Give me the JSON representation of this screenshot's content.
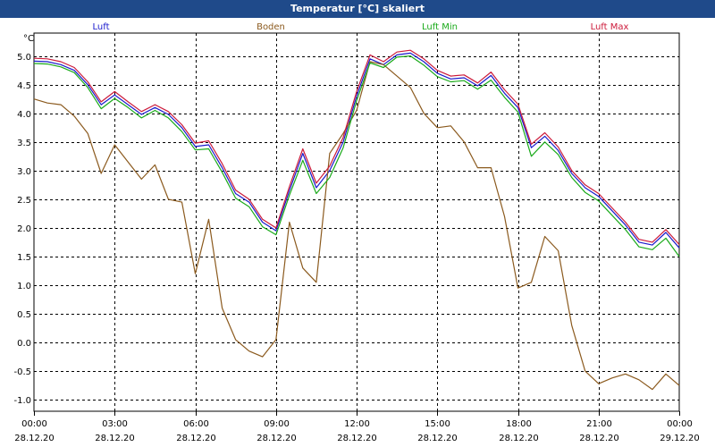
{
  "window": {
    "title": "Temperatur [°C] skaliert"
  },
  "colors": {
    "Luft": "#1a1acc",
    "Boden": "#8b5a1e",
    "Luft Min": "#1aaa1a",
    "Luft Max": "#cc1a3a",
    "grid": "#000000"
  },
  "chart_data": {
    "type": "line",
    "title": "Temperatur [°C] skaliert",
    "ylabel": "°C",
    "xlabel": "",
    "ylim": [
      -1.2,
      5.4
    ],
    "xlim": [
      0,
      24
    ],
    "grid": true,
    "legend_placement": "top",
    "y_ticks": [
      "5.0",
      "4.5",
      "4.0",
      "3.5",
      "3.0",
      "2.5",
      "2.0",
      "1.5",
      "1.0",
      "0.5",
      "0.0",
      "-0.5",
      "-1.0"
    ],
    "y_tick_values": [
      5.0,
      4.5,
      4.0,
      3.5,
      3.0,
      2.5,
      2.0,
      1.5,
      1.0,
      0.5,
      0.0,
      -0.5,
      -1.0
    ],
    "x_ticks": [
      {
        "time": "00:00",
        "date": "28.12.20",
        "h": 0
      },
      {
        "time": "03:00",
        "date": "28.12.20",
        "h": 3
      },
      {
        "time": "06:00",
        "date": "28.12.20",
        "h": 6
      },
      {
        "time": "09:00",
        "date": "28.12.20",
        "h": 9
      },
      {
        "time": "12:00",
        "date": "28.12.20",
        "h": 12
      },
      {
        "time": "15:00",
        "date": "28.12.20",
        "h": 15
      },
      {
        "time": "18:00",
        "date": "28.12.20",
        "h": 18
      },
      {
        "time": "21:00",
        "date": "28.12.20",
        "h": 21
      },
      {
        "time": "00:00",
        "date": "29.12.20",
        "h": 24
      }
    ],
    "series": [
      {
        "name": "Luft",
        "x": [
          0,
          0.5,
          1,
          1.5,
          2,
          2.5,
          3,
          3.5,
          4,
          4.5,
          5,
          5.5,
          6,
          6.5,
          7,
          7.5,
          8,
          8.5,
          9,
          9.5,
          10,
          10.5,
          11,
          11.5,
          12,
          12.5,
          13,
          13.5,
          14,
          14.5,
          15,
          15.5,
          16,
          16.5,
          17,
          17.5,
          18,
          18.5,
          19,
          19.5,
          20,
          20.5,
          21,
          21.5,
          22,
          22.5,
          23,
          23.5,
          24
        ],
        "values": [
          4.91,
          4.9,
          4.85,
          4.75,
          4.5,
          4.15,
          4.32,
          4.15,
          3.98,
          4.1,
          3.98,
          3.75,
          3.42,
          3.45,
          3.05,
          2.6,
          2.45,
          2.1,
          1.95,
          2.65,
          3.3,
          2.7,
          3.0,
          3.5,
          4.3,
          4.95,
          4.85,
          5.02,
          5.05,
          4.9,
          4.7,
          4.6,
          4.62,
          4.48,
          4.66,
          4.35,
          4.1,
          3.4,
          3.6,
          3.35,
          2.95,
          2.7,
          2.55,
          2.3,
          2.05,
          1.75,
          1.7,
          1.92,
          1.65
        ]
      },
      {
        "name": "Boden",
        "x": [
          0,
          0.5,
          1,
          1.5,
          2,
          2.5,
          3,
          3.5,
          4,
          4.5,
          5,
          5.5,
          6,
          6.5,
          7,
          7.5,
          8,
          8.5,
          9,
          9.5,
          10,
          10.5,
          11,
          11.5,
          12,
          12.5,
          13,
          13.5,
          14,
          14.5,
          15,
          15.5,
          16,
          16.5,
          17,
          17.5,
          18,
          18.5,
          19,
          19.5,
          20,
          20.5,
          21,
          21.5,
          22,
          22.5,
          23,
          23.5,
          24
        ],
        "values": [
          4.25,
          4.18,
          4.15,
          3.95,
          3.65,
          2.95,
          3.45,
          3.15,
          2.85,
          3.1,
          2.5,
          2.45,
          1.2,
          2.15,
          0.6,
          0.05,
          -0.15,
          -0.25,
          0.05,
          2.1,
          1.3,
          1.05,
          3.3,
          3.65,
          4.05,
          4.9,
          4.85,
          4.65,
          4.45,
          4.0,
          3.75,
          3.78,
          3.5,
          3.05,
          3.05,
          2.2,
          0.95,
          1.05,
          1.85,
          1.6,
          0.3,
          -0.5,
          -0.72,
          -0.62,
          -0.55,
          -0.65,
          -0.82,
          -0.55,
          -0.75
        ]
      },
      {
        "name": "Luft Min",
        "x": [
          0,
          0.5,
          1,
          1.5,
          2,
          2.5,
          3,
          3.5,
          4,
          4.5,
          5,
          5.5,
          6,
          6.5,
          7,
          7.5,
          8,
          8.5,
          9,
          9.5,
          10,
          10.5,
          11,
          11.5,
          12,
          12.5,
          13,
          13.5,
          14,
          14.5,
          15,
          15.5,
          16,
          16.5,
          17,
          17.5,
          18,
          18.5,
          19,
          19.5,
          20,
          20.5,
          21,
          21.5,
          22,
          22.5,
          23,
          23.5,
          24
        ],
        "values": [
          4.87,
          4.86,
          4.81,
          4.71,
          4.45,
          4.08,
          4.26,
          4.1,
          3.92,
          4.05,
          3.92,
          3.68,
          3.36,
          3.38,
          2.97,
          2.52,
          2.37,
          2.02,
          1.88,
          2.57,
          3.18,
          2.6,
          2.88,
          3.4,
          4.22,
          4.88,
          4.8,
          4.98,
          5.0,
          4.84,
          4.64,
          4.55,
          4.57,
          4.42,
          4.58,
          4.28,
          4.02,
          3.25,
          3.5,
          3.28,
          2.88,
          2.62,
          2.47,
          2.22,
          1.97,
          1.67,
          1.62,
          1.82,
          1.5
        ]
      },
      {
        "name": "Luft Max",
        "x": [
          0,
          0.5,
          1,
          1.5,
          2,
          2.5,
          3,
          3.5,
          4,
          4.5,
          5,
          5.5,
          6,
          6.5,
          7,
          7.5,
          8,
          8.5,
          9,
          9.5,
          10,
          10.5,
          11,
          11.5,
          12,
          12.5,
          13,
          13.5,
          14,
          14.5,
          15,
          15.5,
          16,
          16.5,
          17,
          17.5,
          18,
          18.5,
          19,
          19.5,
          20,
          20.5,
          21,
          21.5,
          22,
          22.5,
          23,
          23.5,
          24
        ],
        "values": [
          4.96,
          4.95,
          4.9,
          4.8,
          4.55,
          4.2,
          4.38,
          4.2,
          4.03,
          4.15,
          4.03,
          3.8,
          3.48,
          3.52,
          3.12,
          2.66,
          2.5,
          2.15,
          2.0,
          2.72,
          3.38,
          2.78,
          3.08,
          3.58,
          4.38,
          5.02,
          4.9,
          5.07,
          5.1,
          4.95,
          4.75,
          4.65,
          4.67,
          4.53,
          4.72,
          4.41,
          4.16,
          3.46,
          3.66,
          3.41,
          3.0,
          2.75,
          2.6,
          2.35,
          2.1,
          1.8,
          1.75,
          1.97,
          1.71
        ]
      }
    ]
  }
}
